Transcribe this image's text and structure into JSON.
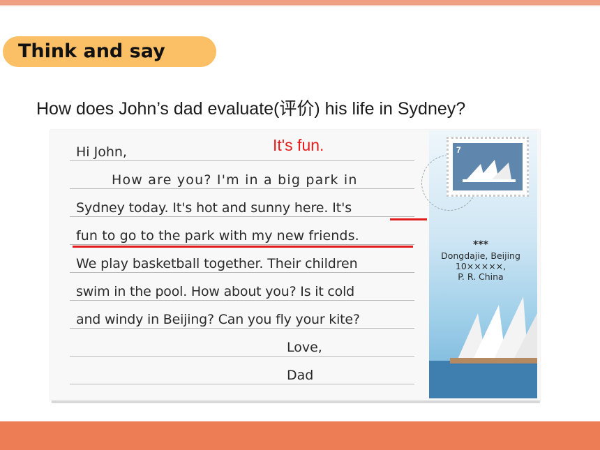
{
  "header": {
    "title": "Think and say"
  },
  "question": "How does John’s dad evaluate(评价) his life in Sydney?",
  "answer": "It's fun.",
  "letter": {
    "lines": [
      "Hi John,",
      "How are you? I'm in a big park in",
      "Sydney today. It's hot and sunny here. It's",
      "fun to go to the park with my new friends.",
      "We play basketball together. Their children",
      "swim in the pool. How about you? Is it cold",
      "and windy in Beijing? Can you fly your kite?",
      "Love,",
      "Dad"
    ]
  },
  "stamp": {
    "value": "7"
  },
  "address": {
    "stars": "***",
    "line1": "Dongdajie, Beijing",
    "line2": "10×××××,",
    "line3": "P. R. China"
  },
  "colors": {
    "accent_orange": "#ec7d54",
    "title_pill": "#fbbf66",
    "answer_red": "#e81b1b"
  }
}
